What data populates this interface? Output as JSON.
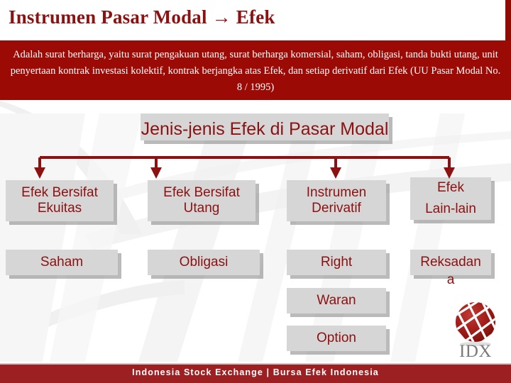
{
  "slide": {
    "title": "Instrumen Pasar Modal  → Efek",
    "definition": "Adalah surat berharga, yaitu surat pengakuan utang, surat berharga komersial, saham, obligasi, tanda bukti utang, unit penyertaan kontrak investasi kolektif, kontrak berjangka atas Efek, dan setiap derivatif dari Efek (UU Pasar Modal  No. 8 / 1995)",
    "colors": {
      "band_red": "#9C0A05",
      "text_red": "#8C1111",
      "box_gray": "#d6d6d6",
      "footer_red": "#9C2022"
    }
  },
  "diagram": {
    "root": {
      "label": "Jenis-jenis Efek di Pasar Modal"
    },
    "categories": [
      {
        "id": "ekuitas",
        "label": "Efek Bersifat Ekuitas"
      },
      {
        "id": "utang",
        "label": "Efek Bersifat Utang"
      },
      {
        "id": "derivatif",
        "label": "Instrumen Derivatif"
      },
      {
        "id": "lainlain",
        "label": "Efek\nLain-lain"
      }
    ],
    "instruments": {
      "ekuitas": [
        "Saham"
      ],
      "utang": [
        "Obligasi"
      ],
      "derivatif": [
        "Right",
        "Waran",
        "Option"
      ],
      "lainlain": [
        "Reksadan"
      ]
    },
    "overflow": {
      "reksadana_tail": "a"
    }
  },
  "logo": {
    "wordmark": "IDX"
  },
  "footer": {
    "text": "Indonesia  Stock  Exchange  |  Bursa  Efek  Indonesia"
  }
}
